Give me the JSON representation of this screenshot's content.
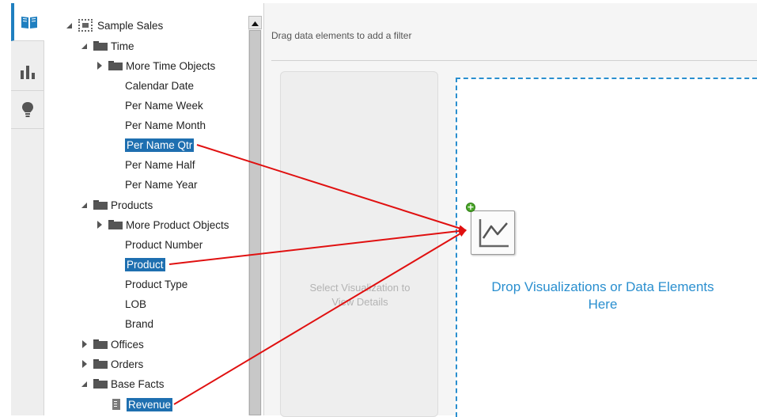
{
  "rail": {
    "tabs": [
      {
        "icon": "book-icon",
        "active": true
      },
      {
        "icon": "bar-chart-icon",
        "active": false
      },
      {
        "icon": "lightbulb-icon",
        "active": false
      }
    ]
  },
  "tree": {
    "root": "Sample Sales",
    "time": {
      "label": "Time",
      "items": [
        "More Time Objects",
        "Calendar Date",
        "Per Name Week",
        "Per Name Month",
        "Per Name Qtr",
        "Per Name Half",
        "Per Name Year"
      ]
    },
    "products": {
      "label": "Products",
      "items": [
        "More Product Objects",
        "Product Number",
        "Product",
        "Product Type",
        "LOB",
        "Brand"
      ]
    },
    "offices": "Offices",
    "orders": "Orders",
    "base_facts": {
      "label": "Base Facts",
      "items": [
        "Revenue"
      ]
    },
    "selected": [
      "Per Name Qtr",
      "Product",
      "Revenue"
    ]
  },
  "filter_bar": {
    "hint": "Drag data elements to add a filter"
  },
  "details": {
    "line1": "Select Visualization to",
    "line2": "View Details"
  },
  "drop_zone": {
    "line1": "Drop Visualizations or Data Elements",
    "line2": "Here",
    "icon": "line-chart-icon",
    "badge": "+"
  },
  "colors": {
    "accent": "#2a8fcf",
    "selection": "#1e6fb0",
    "arrow": "#e01010",
    "add_badge": "#4ca82a"
  }
}
